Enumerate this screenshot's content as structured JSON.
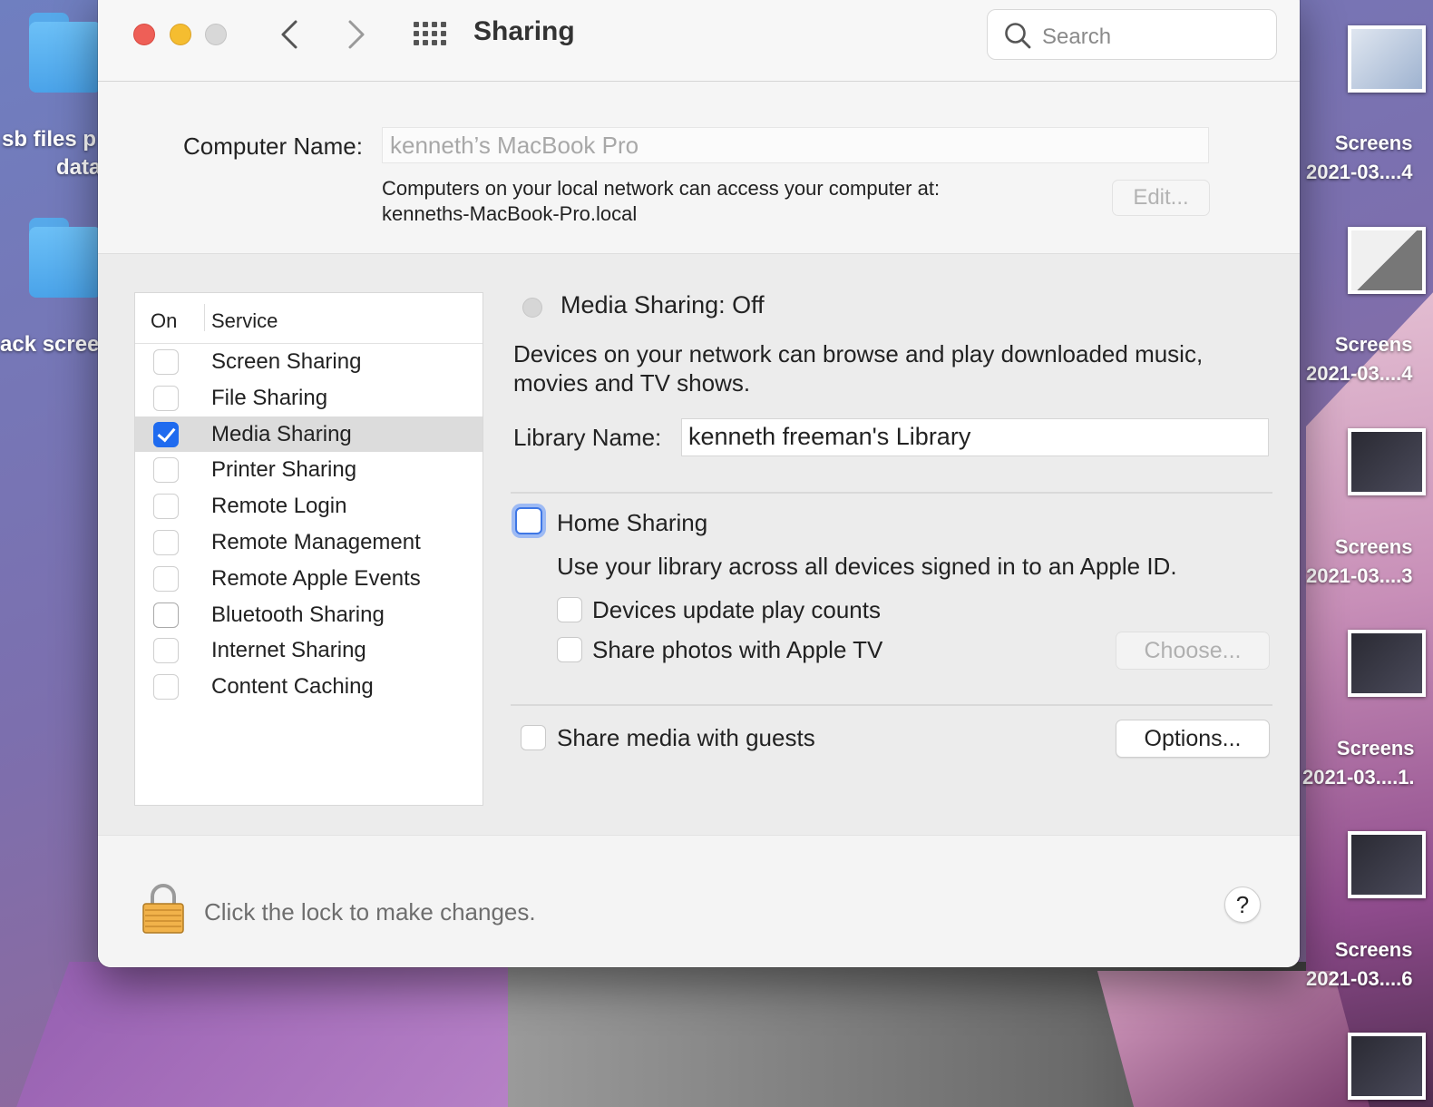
{
  "desktop": {
    "left_items": [
      {
        "label_1": "sb files p",
        "label_2": "data"
      },
      {
        "label_1": "ack scree"
      }
    ],
    "right_items": [
      {
        "label_1": "Screens",
        "label_2": "2021-03....4"
      },
      {
        "label_1": "Screens",
        "label_2": "2021-03....4"
      },
      {
        "label_1": "Screens",
        "label_2": "2021-03....3"
      },
      {
        "label_1": "Screens",
        "label_2": "2021-03....1."
      },
      {
        "label_1": "Screens",
        "label_2": "2021-03....6"
      }
    ]
  },
  "window": {
    "title": "Sharing",
    "search_placeholder": "Search",
    "computer_name": {
      "label": "Computer Name:",
      "value": "kenneth’s MacBook Pro",
      "desc_line1": "Computers on your local network can access your computer at:",
      "desc_line2": "kenneths-MacBook-Pro.local",
      "edit_label": "Edit..."
    },
    "services": {
      "header_on": "On",
      "header_service": "Service",
      "items": [
        {
          "label": "Screen Sharing",
          "checked": false
        },
        {
          "label": "File Sharing",
          "checked": false
        },
        {
          "label": "Media Sharing",
          "checked": true,
          "selected": true
        },
        {
          "label": "Printer Sharing",
          "checked": false
        },
        {
          "label": "Remote Login",
          "checked": false
        },
        {
          "label": "Remote Management",
          "checked": false
        },
        {
          "label": "Remote Apple Events",
          "checked": false
        },
        {
          "label": "Bluetooth Sharing",
          "checked": false
        },
        {
          "label": "Internet Sharing",
          "checked": false
        },
        {
          "label": "Content Caching",
          "checked": false
        }
      ]
    },
    "panel": {
      "status_title": "Media Sharing: Off",
      "status_desc": "Devices on your network can browse and play downloaded music, movies and TV shows.",
      "library_label": "Library Name:",
      "library_value": "kenneth freeman's Library",
      "home_sharing_label": "Home Sharing",
      "home_sharing_desc": "Use your library across all devices signed in to an Apple ID.",
      "play_counts_label": "Devices update play counts",
      "share_photos_label": "Share photos with Apple TV",
      "choose_label": "Choose...",
      "guests_label": "Share media with guests",
      "options_label": "Options..."
    },
    "lock_text": "Click the lock to make changes.",
    "help_label": "?"
  }
}
